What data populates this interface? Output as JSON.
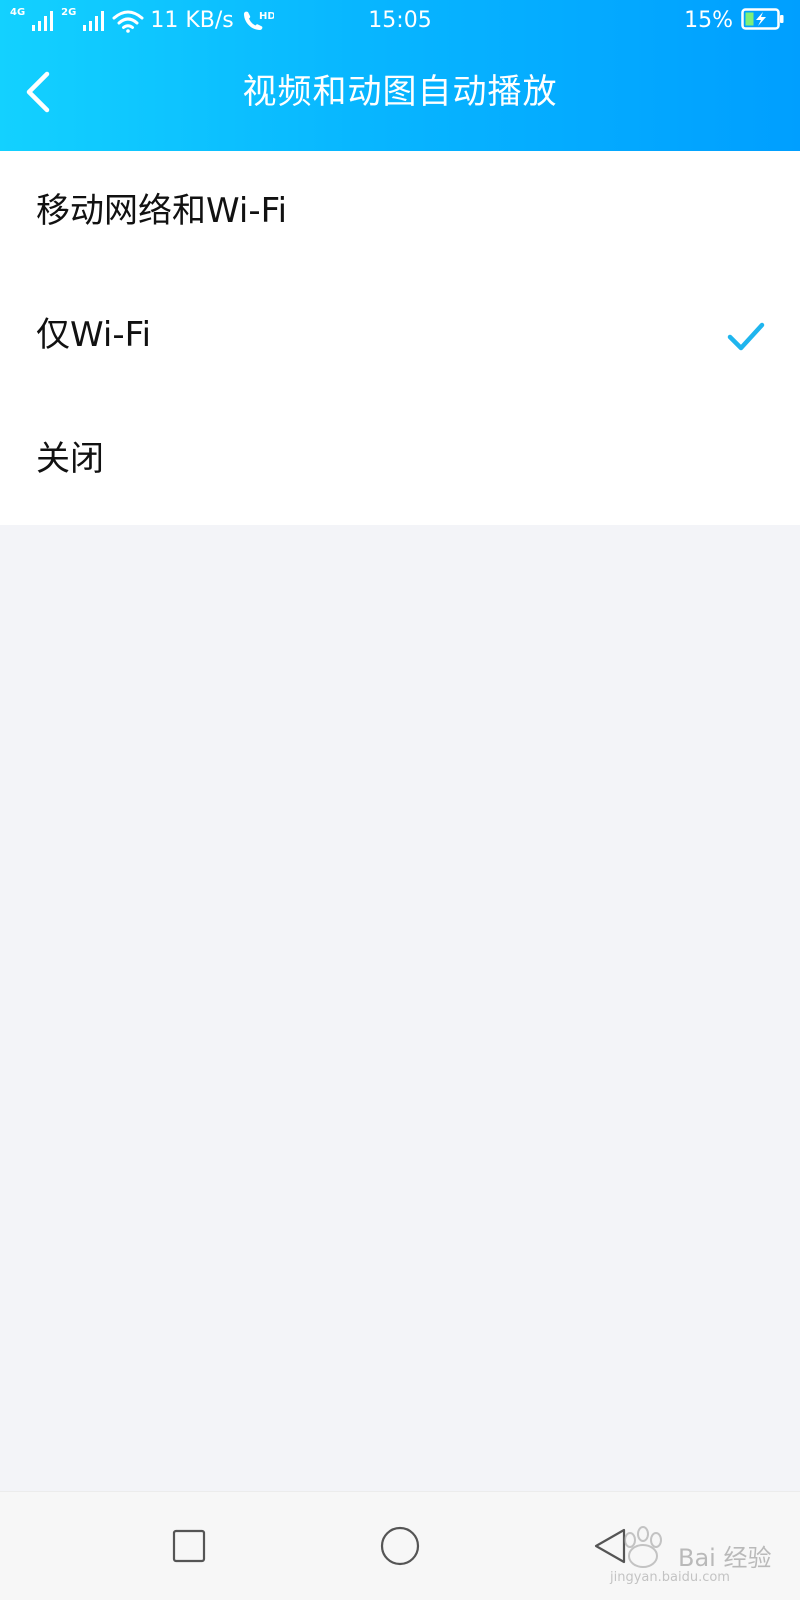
{
  "status_bar": {
    "net1_label": "4G",
    "net2_label": "2G",
    "speed": "11 KB/s",
    "time": "15:05",
    "battery_percent": "15%"
  },
  "header": {
    "title": "视频和动图自动播放",
    "back_icon": "chevron-left-icon"
  },
  "options": [
    {
      "label": "移动网络和Wi-Fi",
      "selected": false
    },
    {
      "label": "仅Wi-Fi",
      "selected": true
    },
    {
      "label": "关闭",
      "selected": false
    }
  ],
  "colors": {
    "header_start": "#13d1ff",
    "header_end": "#009fff",
    "check": "#1fb5ee",
    "page_background": "#f3f4f8"
  },
  "nav_bar": {
    "recents_icon": "square-icon",
    "home_icon": "circle-icon",
    "back_icon": "triangle-back-icon"
  },
  "watermark": {
    "text": "Bai 经验",
    "subtext": "jingyan.baidu.com"
  }
}
